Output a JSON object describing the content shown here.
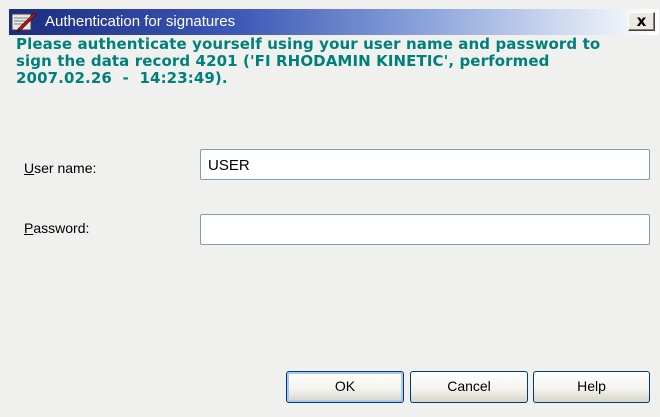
{
  "window": {
    "title": "Authentication for signatures",
    "close_label": "x"
  },
  "message": {
    "line1": "Please authenticate yourself using your user name and password to",
    "line2": "sign the data record 4201 ('FI RHODAMIN KINETIC', performed",
    "line3": "2007.02.26  -  14:23:49)."
  },
  "form": {
    "username_label_access": "U",
    "username_label_rest": "ser name:",
    "username_value": "USER",
    "password_label_access": "P",
    "password_label_rest": "assword:",
    "password_value": ""
  },
  "buttons": {
    "ok": "OK",
    "cancel": "Cancel",
    "help": "Help"
  },
  "colors": {
    "title_gradient_start": "#1c2c80",
    "message_text": "#00807a",
    "dialog_bg": "#f0f0ef"
  }
}
